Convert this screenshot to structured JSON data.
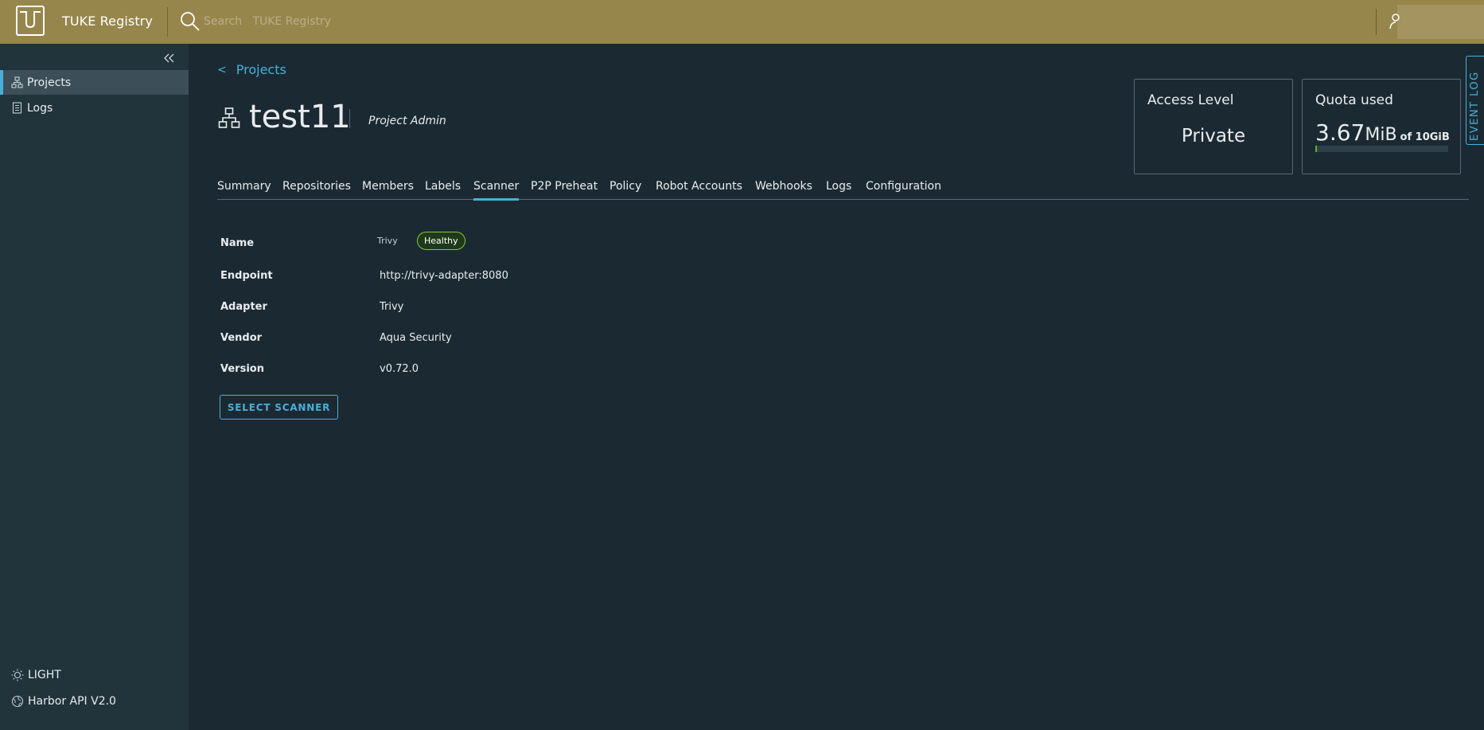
{
  "header": {
    "app_title": "TUKE Registry",
    "search_placeholder": "Search   TUKE Registry"
  },
  "sidebar": {
    "items": [
      {
        "label": "Projects",
        "icon": "projects-icon",
        "active": true
      },
      {
        "label": "Logs",
        "icon": "logs-icon",
        "active": false
      }
    ],
    "theme_label": "LIGHT",
    "api_label": "Harbor API V2.0"
  },
  "main": {
    "back_label": "Projects",
    "project_name": "test11",
    "role": "Project Admin",
    "access_card": {
      "title": "Access Level",
      "value": "Private"
    },
    "quota_card": {
      "title": "Quota used",
      "used_number": "3.67",
      "used_unit": "MiB",
      "of_label": "of 10GiB",
      "fraction_used": 0.0004
    },
    "event_log_label": "EVENT LOG",
    "tabs": [
      {
        "label": "Summary"
      },
      {
        "label": "Repositories"
      },
      {
        "label": "Members"
      },
      {
        "label": "Labels"
      },
      {
        "label": "Scanner",
        "active": true
      },
      {
        "label": "P2P Preheat"
      },
      {
        "label": "Policy"
      },
      {
        "label": "Robot Accounts"
      },
      {
        "label": "Webhooks"
      },
      {
        "label": "Logs"
      },
      {
        "label": "Configuration"
      }
    ],
    "scanner": {
      "name_label": "Name",
      "name_value": "Trivy",
      "health": "Healthy",
      "endpoint_label": "Endpoint",
      "endpoint_value": "http://trivy-adapter:8080",
      "adapter_label": "Adapter",
      "adapter_value": "Trivy",
      "vendor_label": "Vendor",
      "vendor_value": "Aqua Security",
      "version_label": "Version",
      "version_value": "v0.72.0",
      "select_button": "SELECT SCANNER"
    }
  },
  "colors": {
    "header_bg": "#97864b",
    "sidebar_bg": "#21333b",
    "page_bg": "#1b2a32",
    "accent": "#49afd9",
    "healthy": "#8ac33d"
  }
}
